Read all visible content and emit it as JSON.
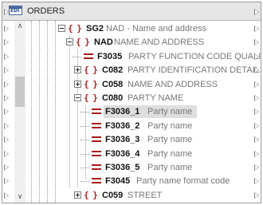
{
  "component": {
    "title": "ORDERS",
    "icon": "edi-component-icon"
  },
  "scrollbar": {
    "up_glyph": "∧",
    "down_glyph": "∨"
  },
  "tree": [
    {
      "kind": "group",
      "expander": "minus",
      "name": "SG2",
      "desc": "NAD - Name and address"
    },
    {
      "kind": "group",
      "expander": "minus",
      "name": "NAD",
      "desc": "NAME AND ADDRESS"
    },
    {
      "kind": "field",
      "name": "F3035",
      "desc": "PARTY FUNCTION CODE QUALIF"
    },
    {
      "kind": "group",
      "expander": "plus",
      "name": "C082",
      "desc": "PARTY IDENTIFICATION DETAILS"
    },
    {
      "kind": "group",
      "expander": "plus",
      "name": "C058",
      "desc": "NAME AND ADDRESS"
    },
    {
      "kind": "group",
      "expander": "minus",
      "name": "C080",
      "desc": "PARTY NAME"
    },
    {
      "kind": "field",
      "name": "F3036_1",
      "desc": "Party name",
      "selected": true
    },
    {
      "kind": "field",
      "name": "F3036_2",
      "desc": "Party name"
    },
    {
      "kind": "field",
      "name": "F3036_3",
      "desc": "Party name"
    },
    {
      "kind": "field",
      "name": "F3036_4",
      "desc": "Party name"
    },
    {
      "kind": "field",
      "name": "F3036_5",
      "desc": "Party name"
    },
    {
      "kind": "field",
      "name": "F3045",
      "desc": "Party name format code"
    },
    {
      "kind": "group",
      "expander": "plus",
      "name": "C059",
      "desc": "STREET"
    }
  ],
  "colors": {
    "group_icon": "#b02020",
    "field_icon": "#a51c1c",
    "selection": "#dedede",
    "description": "#777777"
  }
}
